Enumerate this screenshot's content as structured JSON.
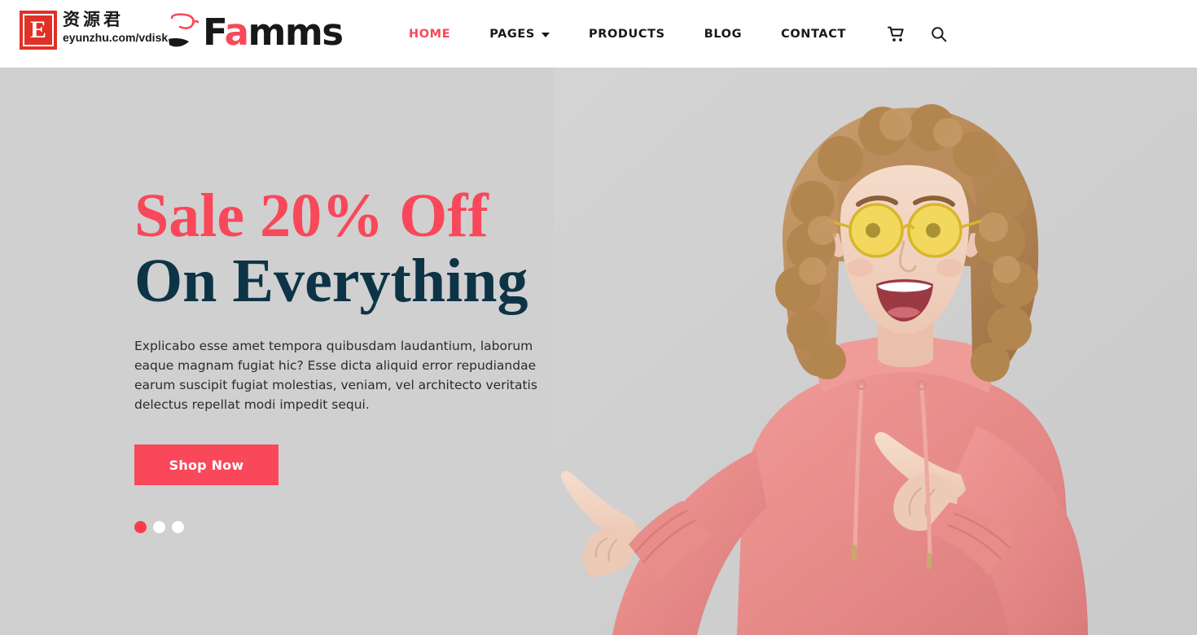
{
  "header": {
    "watermark": {
      "badge_letter": "E",
      "cn_text": "资源君",
      "url_text": "eyunzhu.com/vdisk"
    },
    "brand": {
      "name_part1": "F",
      "name_accent": "a",
      "name_part2": "mms",
      "logo_mark_name": "glasses-mark-icon"
    },
    "nav": [
      {
        "label": "HOME",
        "active": true,
        "has_caret": false
      },
      {
        "label": "PAGES",
        "active": false,
        "has_caret": true
      },
      {
        "label": "PRODUCTS",
        "active": false,
        "has_caret": false
      },
      {
        "label": "BLOG",
        "active": false,
        "has_caret": false
      },
      {
        "label": "CONTACT",
        "active": false,
        "has_caret": false
      }
    ],
    "icons": [
      {
        "name": "cart-icon"
      },
      {
        "name": "search-icon"
      }
    ]
  },
  "hero": {
    "headline_line1": "Sale 20% Off",
    "headline_line2": "On Everything",
    "paragraph": "Explicabo esse amet tempora quibusdam laudantium, laborum eaque magnam fugiat hic? Esse dicta aliquid error repudiandae earum suscipit fugiat molestias, veniam, vel architecto veritatis delectus repellat modi impedit sequi.",
    "cta_label": "Shop Now",
    "slides": [
      {
        "index": 1,
        "active": true
      },
      {
        "index": 2,
        "active": false
      },
      {
        "index": 3,
        "active": false
      }
    ],
    "photo_alt": "woman in pink hoodie with yellow round sunglasses pointing both ways"
  },
  "colors": {
    "accent": "#f8485a",
    "accent_dot": "#fb3a4e",
    "navy": "#0d3446",
    "hero_bg": "#d0d0d0",
    "header_bg": "#ffffff",
    "text_dark": "#17181a",
    "hoodie_pink": "#e5918f",
    "watermark_red": "#e03127",
    "sunglasses_yellow": "#f0d23a"
  }
}
